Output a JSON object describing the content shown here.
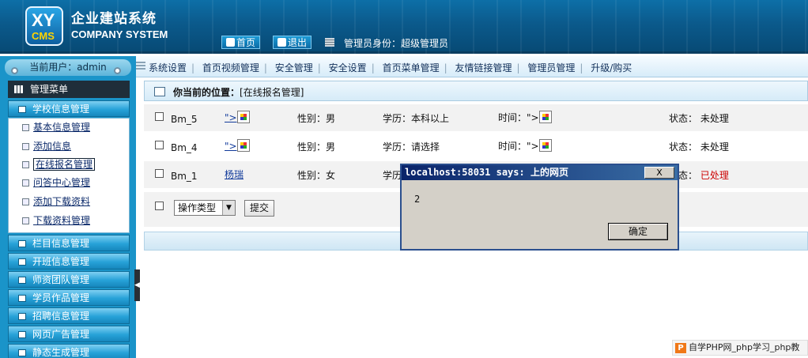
{
  "header": {
    "logo_top": "XY",
    "logo_bottom": "CMS",
    "title_cn": "企业建站系统",
    "title_en": "COMPANY SYSTEM",
    "home_label": "首页",
    "logout_label": "退出",
    "admin_info": "管理员身份：超级管理员"
  },
  "sidebar": {
    "current_user": "当前用户：admin",
    "menu_title": "管理菜单",
    "groups": [
      {
        "label": "学校信息管理"
      },
      {
        "label": "栏目信息管理"
      },
      {
        "label": "开班信息管理"
      },
      {
        "label": "师资团队管理"
      },
      {
        "label": "学员作品管理"
      },
      {
        "label": "招聘信息管理"
      },
      {
        "label": "网页广告管理"
      },
      {
        "label": "静态生成管理"
      }
    ],
    "subitems": [
      {
        "label": "基本信息管理"
      },
      {
        "label": "添加信息"
      },
      {
        "label": "在线报名管理"
      },
      {
        "label": "问答中心管理"
      },
      {
        "label": "添加下载资料"
      },
      {
        "label": "下载资料管理"
      }
    ]
  },
  "topnav": {
    "items": [
      "系统设置",
      "首页视频管理",
      "安全管理",
      "安全设置",
      "首页菜单管理",
      "友情链接管理",
      "管理员管理",
      "升级/购买"
    ]
  },
  "content": {
    "location_label": "你当前的位置：",
    "location_value": "[在线报名管理]",
    "rows": [
      {
        "id": "Bm_5",
        "name": "\">",
        "gender": "性别：男",
        "education": "学历：本科以上",
        "time": "时间：\">",
        "status_label": "状态：",
        "status": "未处理"
      },
      {
        "id": "Bm_4",
        "name": "\">",
        "gender": "性别：男",
        "education": "学历：请选择",
        "time": "时间：\">",
        "status_label": "状态：",
        "status": "未处理"
      },
      {
        "id": "Bm_1",
        "name": "杨瑞",
        "gender": "性别：女",
        "education": "学历",
        "time": "",
        "status_label": "态：",
        "status": "已处理"
      }
    ],
    "action_select": "操作类型",
    "submit_label": "提交"
  },
  "dialog": {
    "title": "localhost:58031 says: 上的网页",
    "close_label": "X",
    "message": "2",
    "ok_label": "确定"
  },
  "watermark": {
    "icon": "P",
    "text": "自学PHP网_php学习_php教"
  }
}
